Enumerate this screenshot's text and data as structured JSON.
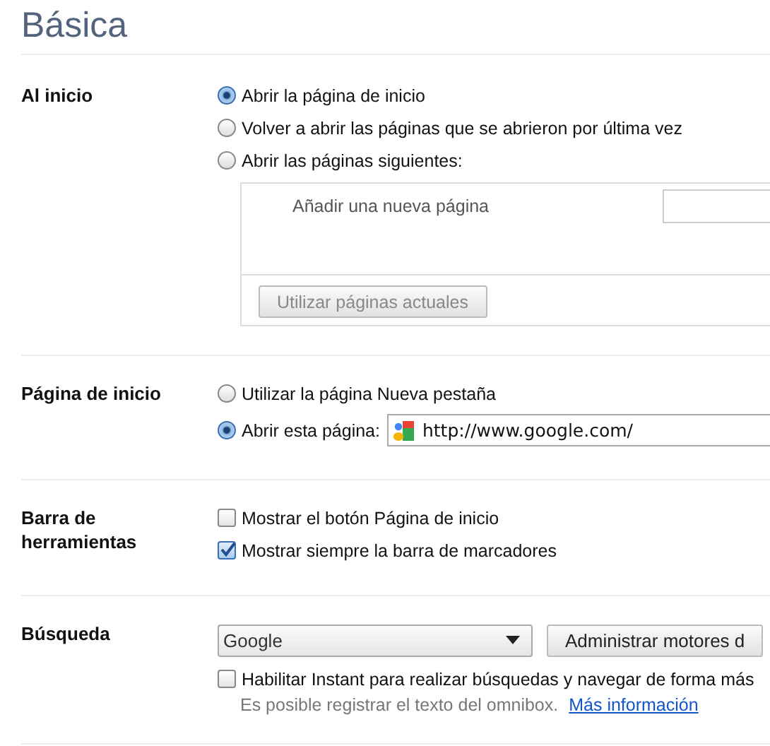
{
  "title": "Básica",
  "sections": [
    {
      "label": "Al inicio",
      "items": [
        {
          "kind": "radio",
          "label": "Abrir la página de inicio",
          "selected": true
        },
        {
          "kind": "radio",
          "label": "Volver a abrir las páginas que se abrieron por última vez",
          "selected": false
        },
        {
          "kind": "radio",
          "label": "Abrir las páginas siguientes:",
          "selected": false
        },
        {
          "kind": "pages",
          "label": "Añadir una nueva página",
          "button": "Utilizar páginas actuales",
          "disabled": true
        }
      ]
    },
    {
      "label": "Página de inicio",
      "items": [
        {
          "kind": "radio",
          "label": "Utilizar la página Nueva pestaña",
          "selected": false
        },
        {
          "kind": "url-radio",
          "label": "Abrir esta página:",
          "selected": true,
          "value": "http://www.google.com/"
        }
      ]
    },
    {
      "label": "Barra de herramientas",
      "items": [
        {
          "kind": "checkbox",
          "label": "Mostrar el botón Página de inicio",
          "checked": false
        },
        {
          "kind": "checkbox",
          "label": "Mostrar siempre la barra de marcadores",
          "checked": true
        }
      ]
    },
    {
      "label": "Búsqueda",
      "items": [
        {
          "kind": "select",
          "value": "Google",
          "button": "Administrar motores d"
        },
        {
          "kind": "checkbox",
          "label": "Habilitar Instant para realizar búsquedas y navegar de forma más",
          "checked": false
        },
        {
          "kind": "note",
          "text": "Es posible registrar el texto del omnibox.",
          "link": "Más información"
        }
      ]
    }
  ]
}
